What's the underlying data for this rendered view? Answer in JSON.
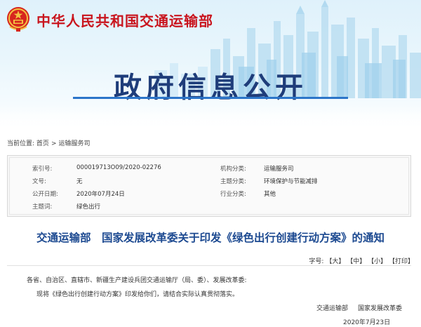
{
  "header": {
    "ministry_name": "中华人民共和国交通运输部",
    "section_title": "政府信息公开"
  },
  "breadcrumb": {
    "prefix": "当前位置:",
    "items": [
      "首页",
      "运输服务司"
    ],
    "separator": ">"
  },
  "info": {
    "index_label": "索引号:",
    "index_value": "000019713O09/2020-02276",
    "agency_label": "机构分类:",
    "agency_value": "运输服务司",
    "docno_label": "文号:",
    "docno_value": "无",
    "topic_label": "主题分类:",
    "topic_value": "环境保护与节能减排",
    "date_label": "公开日期:",
    "date_value": "2020年07月24日",
    "industry_label": "行业分类:",
    "industry_value": "其他",
    "keyword_label": "主题词:",
    "keyword_value": "绿色出行"
  },
  "article": {
    "title": "交通运输部　国家发展改革委关于印发《绿色出行创建行动方案》的通知",
    "font_size_label": "字号:",
    "font_large": "【大】",
    "font_medium": "【中】",
    "font_small": "【小】",
    "print": "【打印】",
    "salutation": "各省、自治区、直辖市、新疆生产建设兵团交通运输厅（局、委）、发展改革委:",
    "body": "现将《绿色出行创建行动方案》印发给你们，请结合实际认真贯彻落实。",
    "signer_1": "交通运输部",
    "signer_2": "国家发展改革委",
    "date": "2020年7月23日"
  },
  "colors": {
    "ministry_red": "#c9151e",
    "title_blue": "#1f3d7a",
    "article_title_blue": "#1d4a91",
    "accent_blue": "#2c75c9"
  }
}
